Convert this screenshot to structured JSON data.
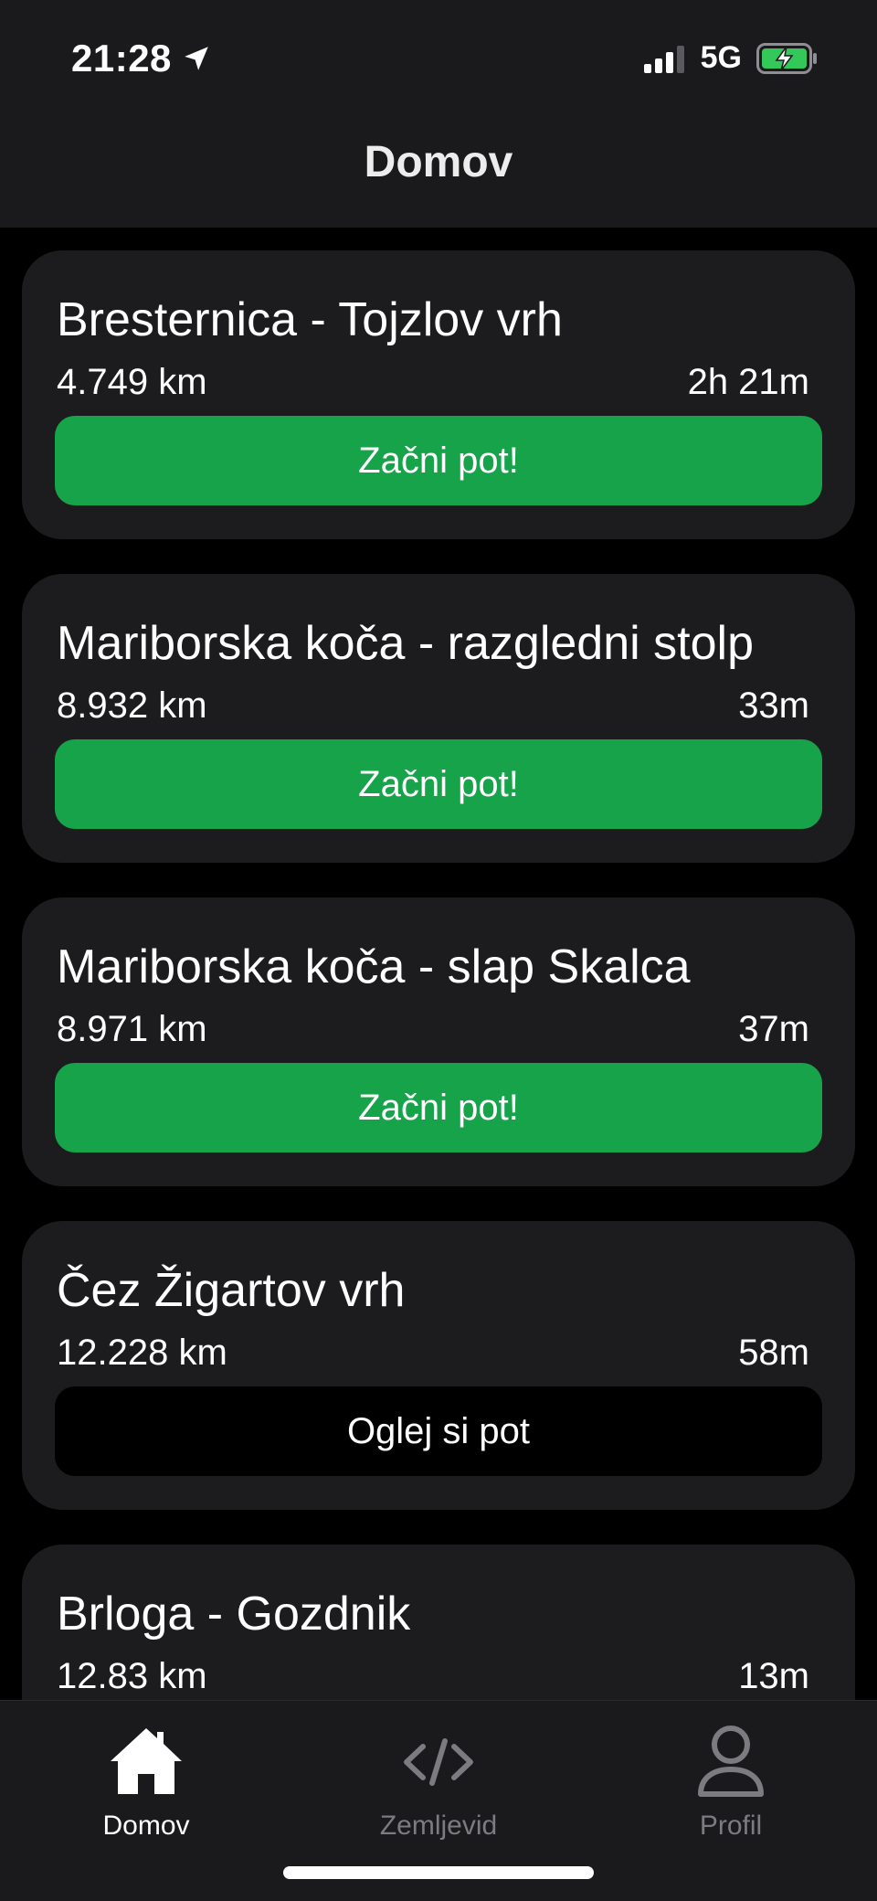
{
  "status_bar": {
    "time": "21:28",
    "network": "5G",
    "location_icon": "location-arrow-icon",
    "signal_icon": "signal-bars-icon",
    "battery_icon": "battery-charging-icon",
    "battery_color": "#34c759"
  },
  "header": {
    "title": "Domov"
  },
  "trails": [
    {
      "title": "Bresternica - Tojzlov vrh",
      "distance": "4.749 km",
      "duration": "2h 21m",
      "button": "Začni pot!",
      "button_style": "start"
    },
    {
      "title": "Mariborska koča - razgledni stolp",
      "distance": "8.932 km",
      "duration": "33m",
      "button": "Začni pot!",
      "button_style": "start"
    },
    {
      "title": "Mariborska koča - slap Skalca",
      "distance": "8.971 km",
      "duration": "37m",
      "button": "Začni pot!",
      "button_style": "start"
    },
    {
      "title": "Čez Žigartov vrh",
      "distance": "12.228 km",
      "duration": "58m",
      "button": "Oglej si pot",
      "button_style": "view"
    },
    {
      "title": "Brloga - Gozdnik",
      "distance": "12.83 km",
      "duration": "13m",
      "button": "",
      "button_style": "start"
    }
  ],
  "tabbar": {
    "tabs": [
      {
        "label": "Domov",
        "icon": "home-icon",
        "active": true
      },
      {
        "label": "Zemljevid",
        "icon": "code-icon",
        "active": false
      },
      {
        "label": "Profil",
        "icon": "user-icon",
        "active": false
      }
    ]
  },
  "colors": {
    "accent_green": "#16a34a",
    "card_bg": "#1c1c1e",
    "background": "#000000"
  }
}
